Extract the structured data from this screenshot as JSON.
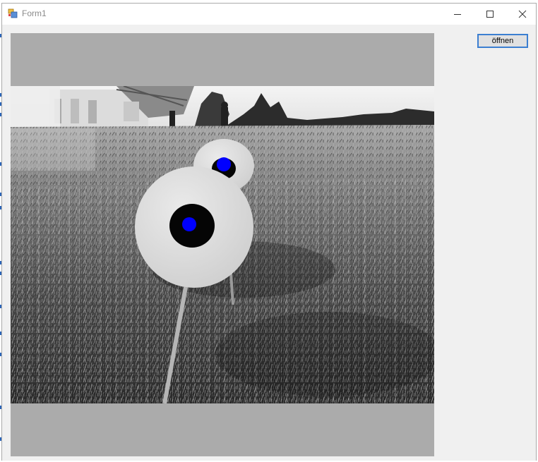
{
  "window": {
    "title": "Form1"
  },
  "toolbar": {
    "open_label": "öffnen"
  },
  "colors": {
    "marker": "#0000ff",
    "picture_background": "#ababab",
    "button_border": "#3c7fd1"
  }
}
